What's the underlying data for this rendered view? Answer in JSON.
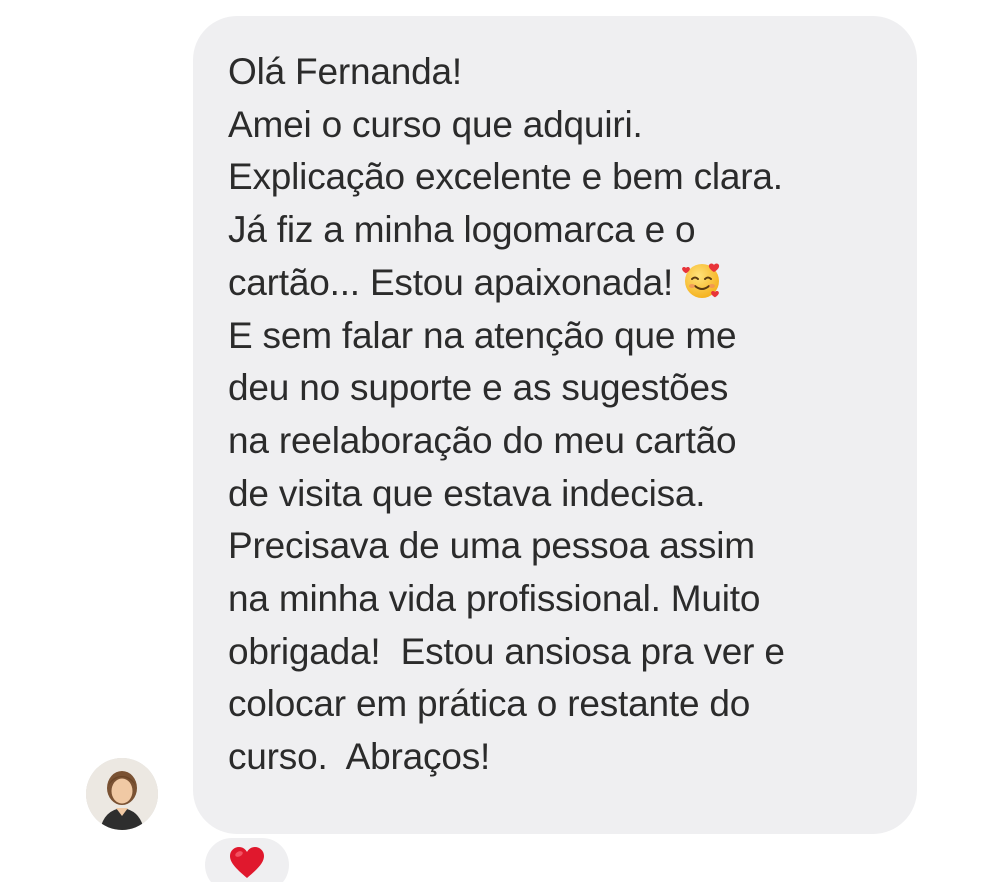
{
  "message": {
    "lines": [
      "Olá Fernanda!",
      "Amei o curso que adquiri.",
      "Explicação excelente e bem clara.",
      "Já fiz a minha logomarca e o",
      "cartão... Estou apaixonada!",
      "E sem falar na atenção que me",
      "deu no suporte e as sugestões",
      "na reelaboração do meu cartão",
      "de visita que estava indecisa.",
      "Precisava de uma pessoa assim",
      "na minha vida profissional. Muito",
      "obrigada!  Estou ansiosa pra ver e",
      "colocar em prática o restante do",
      "curso.  Abraços!"
    ],
    "emoji": "smiling-face-with-hearts-icon"
  },
  "sender": {
    "avatar": "avatar-photo"
  },
  "reaction": {
    "icon": "red-heart-icon",
    "color": "#e0182d"
  },
  "colors": {
    "bubble": "#efeff1",
    "text": "#2b2b2b",
    "background": "#ffffff"
  }
}
